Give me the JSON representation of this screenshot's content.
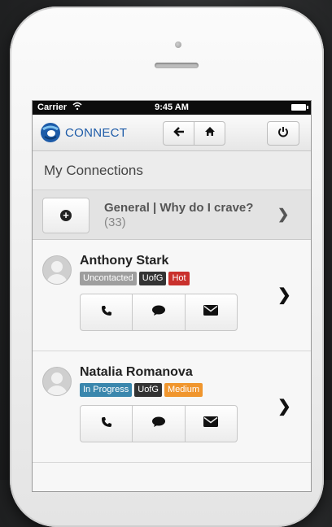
{
  "status_bar": {
    "carrier": "Carrier",
    "time": "9:45 AM"
  },
  "nav": {
    "brand": "CONNECT",
    "back_icon": "arrow-left-icon",
    "home_icon": "home-icon",
    "power_icon": "power-icon"
  },
  "page": {
    "title": "My Connections"
  },
  "group": {
    "name": "General | Why do I crave?",
    "count": "(33)"
  },
  "contacts": [
    {
      "name": "Anthony Stark",
      "tags": [
        {
          "label": "Uncontacted",
          "color": "#9e9e9e"
        },
        {
          "label": "UofG",
          "color": "#333333"
        },
        {
          "label": "Hot",
          "color": "#c9302c"
        }
      ]
    },
    {
      "name": "Natalia Romanova",
      "tags": [
        {
          "label": "In Progress",
          "color": "#3a87ad"
        },
        {
          "label": "UofG",
          "color": "#333333"
        },
        {
          "label": "Medium",
          "color": "#f0962e"
        }
      ]
    }
  ],
  "colors": {
    "brand": "#1d5ba8"
  }
}
